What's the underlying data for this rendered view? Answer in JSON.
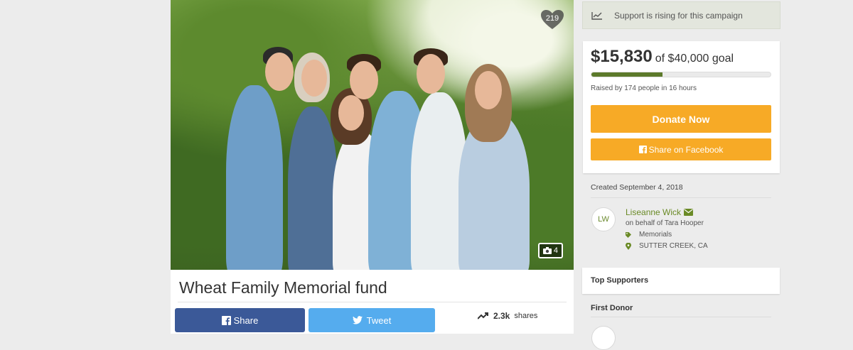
{
  "campaign": {
    "title": "Wheat Family Memorial fund",
    "hearts": "219",
    "photo_count": "4",
    "photo_icon": "camera-icon"
  },
  "social": {
    "share_label": "Share",
    "tweet_label": "Tweet",
    "shares_value": "2.3k",
    "shares_label": "shares"
  },
  "sidebar": {
    "rising_text": "Support is rising for this campaign",
    "raised_amount": "$15,830",
    "goal_text": "of $40,000 goal",
    "progress": 0.396,
    "raised_by": "Raised by 174 people in 16 hours",
    "donate_label": "Donate Now",
    "share_facebook_label": "Share on Facebook",
    "created": "Created September 4, 2018",
    "organizer": {
      "initials": "LW",
      "name": "Liseanne Wick",
      "behalf": "on behalf of Tara Hooper",
      "category": "Memorials",
      "location": "SUTTER CREEK, CA"
    },
    "top_supporters_label": "Top Supporters",
    "first_donor_label": "First Donor"
  },
  "colors": {
    "accent_green": "#6a8a26",
    "donate_orange": "#f7aa26",
    "facebook_blue": "#3b5998",
    "twitter_blue": "#55acee"
  }
}
